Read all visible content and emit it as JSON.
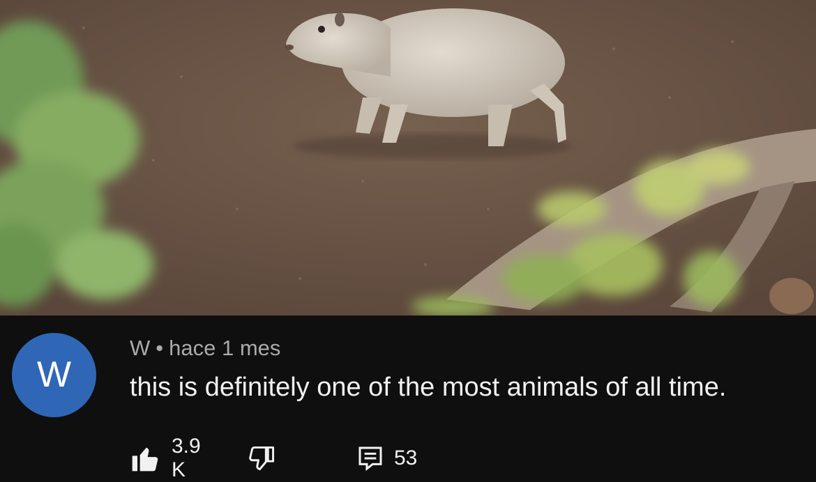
{
  "comment": {
    "avatar_letter": "W",
    "author": "W",
    "separator": "•",
    "timestamp": "hace 1 mes",
    "text": "this is definitely one of the most animals of all time."
  },
  "actions": {
    "like_icon": "thumbs-up-icon",
    "like_count": "3.9 K",
    "dislike_icon": "thumbs-down-icon",
    "reply_icon": "comment-icon",
    "reply_count": "53"
  },
  "colors": {
    "avatar_bg": "#2f67b6",
    "background": "#0f0f0f",
    "text": "#f1f1f1",
    "meta_text": "#aaaaaa"
  }
}
